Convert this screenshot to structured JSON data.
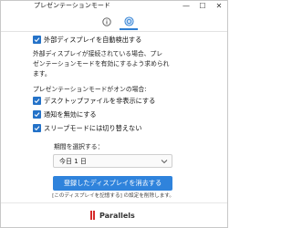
{
  "window": {
    "title": "プレゼンテーションモード",
    "minimize_glyph": "—",
    "maximize_glyph": "☐",
    "close_glyph": "✕"
  },
  "tabs": [
    {
      "icon": "info-icon",
      "active": false
    },
    {
      "icon": "display-icon",
      "active": true
    }
  ],
  "settings": {
    "auto_detect_label": "外部ディスプレイを自動検出する",
    "auto_detect_checked": true,
    "description_line1": "外部ディスプレイが接続されている場合、プレ",
    "description_line2": "ゼンテーションモードを有効にするよう求められ",
    "description_line3": "ます。",
    "when_on_label": "プレゼンテーションモードがオンの場合:",
    "options": [
      {
        "label": "デスクトップファイルを非表示にする",
        "checked": true
      },
      {
        "label": "通知を無効にする",
        "checked": true
      },
      {
        "label": "スリープモードには切り替えない",
        "checked": true
      }
    ],
    "period_label": "期間を選択する：",
    "period_value": "今日 1 日"
  },
  "actions": {
    "forget_button": "登録したディスプレイを消去する",
    "footnote": "[このディスプレイを記憶する] の設定を削除します。"
  },
  "branding": {
    "name": "Parallels"
  },
  "colors": {
    "accent": "#2f83dc",
    "checkbox": "#2472c8",
    "brand_red": "#d62b2b"
  }
}
